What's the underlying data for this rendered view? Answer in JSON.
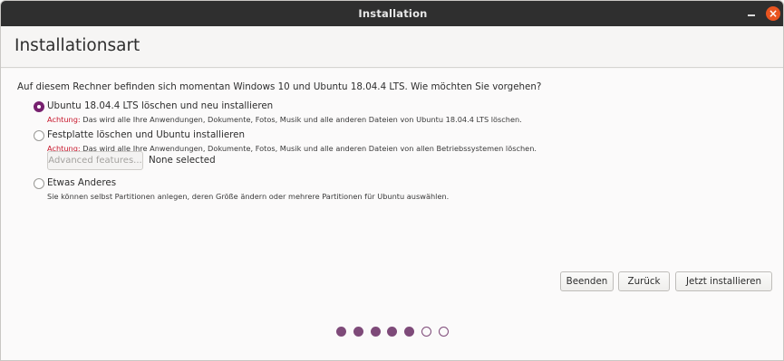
{
  "window": {
    "title": "Installation",
    "minimize_glyph": "",
    "close_glyph": "×"
  },
  "header": {
    "page_title": "Installationsart"
  },
  "main": {
    "question": "Auf diesem Rechner befinden sich momentan Windows 10 und Ubuntu 18.04.4 LTS. Wie möchten Sie vorgehen?",
    "options": [
      {
        "label": "Ubuntu 18.04.4 LTS löschen und neu installieren",
        "checked": true,
        "warn_prefix": "Achtung:",
        "warn_text": " Das wird alle Ihre Anwendungen, Dokumente, Fotos, Musik und alle anderen Dateien von Ubuntu 18.04.4 LTS löschen."
      },
      {
        "label": "Festplatte löschen und Ubuntu installieren",
        "checked": false,
        "warn_prefix": "Achtung:",
        "warn_text": " Das wird alle Ihre Anwendungen, Dokumente, Fotos, Musik und alle anderen Dateien von allen Betriebssystemen löschen."
      },
      {
        "label": "Etwas Anderes",
        "checked": false,
        "description": "Sie können selbst Partitionen anlegen, deren Größe ändern oder mehrere Partitionen für Ubuntu auswählen."
      }
    ],
    "advanced_button": "Advanced features...",
    "advanced_status": "None selected"
  },
  "buttons": {
    "quit": "Beenden",
    "back": "Zurück",
    "install": "Jetzt installieren"
  },
  "progress": {
    "current_step": 5,
    "total_steps": 7
  },
  "colors": {
    "accent": "#77216f",
    "close_button": "#e95420",
    "warning": "#c7162b",
    "progress_dot": "#7e4a79"
  }
}
